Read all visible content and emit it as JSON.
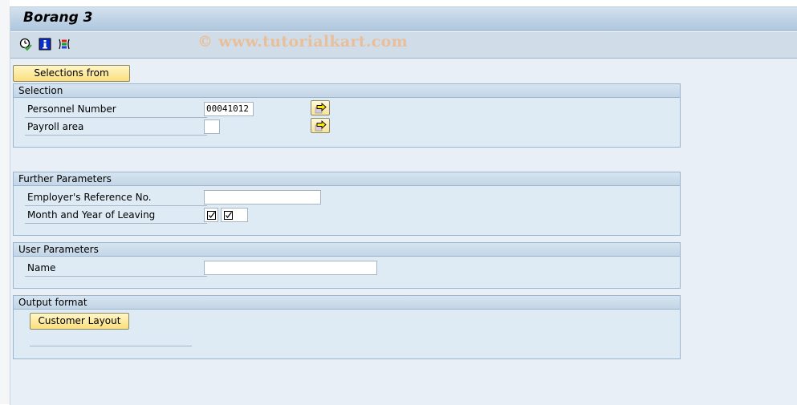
{
  "window": {
    "title": "Borang 3",
    "watermark": "© www.tutorialkart.com"
  },
  "toolbar": {
    "icons": [
      {
        "name": "execute-clock-icon",
        "tooltip": "Execute"
      },
      {
        "name": "information-icon",
        "tooltip": "Information"
      },
      {
        "name": "selection-options-icon",
        "tooltip": "Selection options"
      }
    ]
  },
  "selections_from_button": "Selections from",
  "groups": {
    "selection": {
      "title": "Selection",
      "fields": [
        {
          "label": "Personnel Number",
          "value": "00041012"
        },
        {
          "label": "Payroll area",
          "value": ""
        }
      ]
    },
    "further_parameters": {
      "title": "Further Parameters",
      "fields": [
        {
          "label": "Employer's Reference No.",
          "value": ""
        },
        {
          "label": "Month and Year of Leaving",
          "month_checked": true,
          "year_checked": true
        }
      ]
    },
    "user_parameters": {
      "title": "User Parameters",
      "fields": [
        {
          "label": "Name",
          "value": ""
        }
      ]
    },
    "output_format": {
      "title": "Output format",
      "button": "Customer Layout"
    }
  }
}
